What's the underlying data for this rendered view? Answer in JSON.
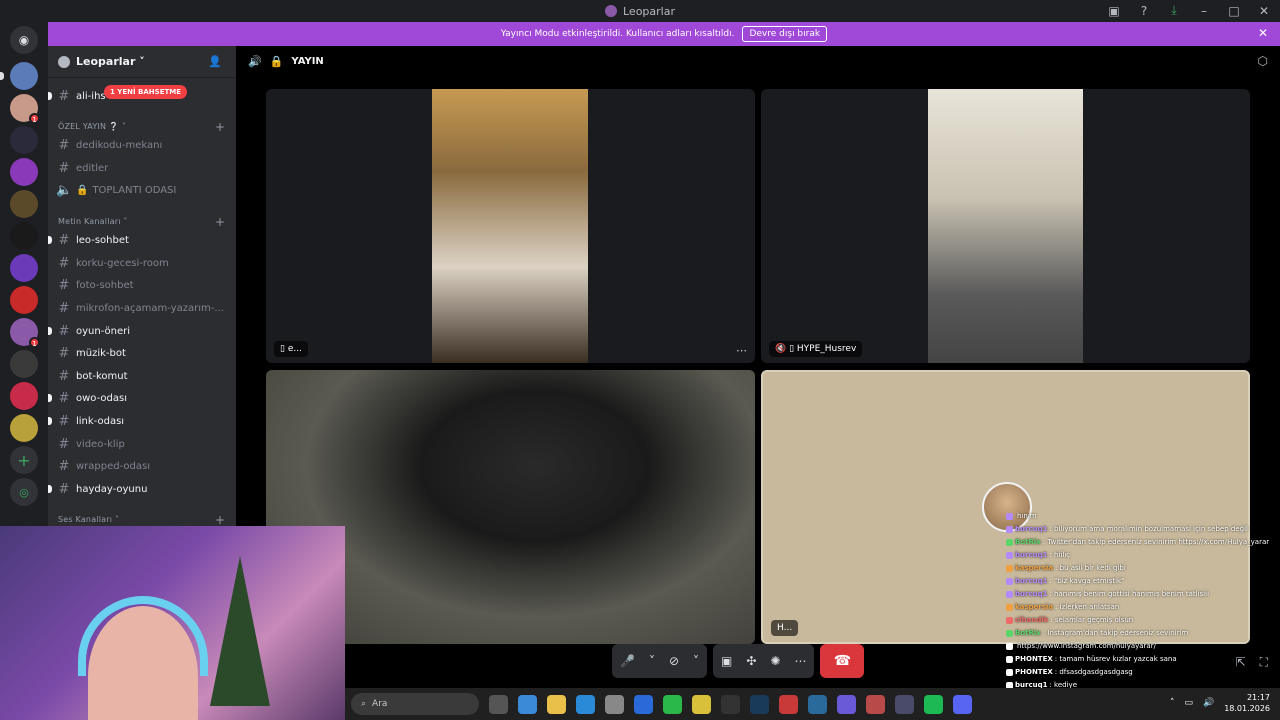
{
  "window": {
    "title": "Leoparlar"
  },
  "banner": {
    "text": "Yayıncı Modu etkinleştirildi. Kullanıcı adları kısaltıldı.",
    "button": "Devre dışı bırak"
  },
  "guild": {
    "name": "Leoparlar ˅"
  },
  "channels": {
    "first": {
      "name": "ali-ihs",
      "mention": "1 YENİ BAHSETME"
    },
    "cat_ozel": "ÖZEL YAYIN ❔ ˅",
    "ozel": [
      "dedikodu-mekanı",
      "editler",
      "TOPLANTI ODASI"
    ],
    "cat_metin": "Metin Kanalları ˅",
    "metin": [
      {
        "name": "leo-sohbet",
        "unread": true
      },
      {
        "name": "korku-gecesi-room",
        "unread": false
      },
      {
        "name": "foto-sohbet",
        "unread": false
      },
      {
        "name": "mikrofon-açamam-yazarım-...",
        "unread": false
      },
      {
        "name": "oyun-öneri",
        "unread": true
      },
      {
        "name": "müzik-bot",
        "unread": true
      },
      {
        "name": "bot-komut",
        "unread": true
      },
      {
        "name": "owo-odası",
        "unread": true
      },
      {
        "name": "link-odası",
        "unread": true
      },
      {
        "name": "video-klip",
        "unread": false
      },
      {
        "name": "wrapped-odası",
        "unread": false
      },
      {
        "name": "hayday-oyunu",
        "unread": true
      }
    ],
    "cat_ses": "Ses Kanalları ˅"
  },
  "call": {
    "channel": "YAYIN",
    "tiles": [
      {
        "name": "e..."
      },
      {
        "name": "HYPE_Husrev"
      },
      {
        "name": ""
      },
      {
        "name": "H..."
      }
    ]
  },
  "taskbar": {
    "search": "Ara",
    "time": "21:17",
    "date": "18.01.2026"
  },
  "chat": [
    {
      "user": "",
      "color": "#b48aff",
      "text": "hınım"
    },
    {
      "user": "burcuq1",
      "color": "#b48aff",
      "text": ": biliyorum ama moralimin bozulmamasi için sebep değil"
    },
    {
      "user": "BotRix",
      "color": "#5bd66b",
      "text": ": Twitter'dan takip ederseniz sevinirim https://x.com/Hulya_yarar"
    },
    {
      "user": "burcuq1",
      "color": "#b48aff",
      "text": ": hiiliç"
    },
    {
      "user": "kaspersia",
      "color": "#f0a040",
      "text": ": bu asil bir kedi gibi"
    },
    {
      "user": "burcuq1",
      "color": "#b48aff",
      "text": ": \"biz kavga etmiştik\""
    },
    {
      "user": "burcuq1",
      "color": "#b48aff",
      "text": ": hanımış benim gottisi hanımış benim tatlisiii"
    },
    {
      "user": "kaspersia",
      "color": "#f0a040",
      "text": ": izlerken anlatsan"
    },
    {
      "user": "cihandik",
      "color": "#f06a6a",
      "text": ": selamlar geçmiş olsun"
    },
    {
      "user": "BotRix",
      "color": "#5bd66b",
      "text": ": Instagram'dan takip ederseniz sevinirim"
    },
    {
      "user": "",
      "color": "#ffffff",
      "text": "https://www.instagram.com/hulyayarar/"
    },
    {
      "user": "PHONTEX",
      "color": "#ffffff",
      "text": ": tamam hüsrev kızlar yazcak sana"
    },
    {
      "user": "PHONTEX",
      "color": "#ffffff",
      "text": ": dfsasdgasdgasdgasg"
    },
    {
      "user": "burcuq1",
      "color": "#ffffff",
      "text": ": kediye"
    },
    {
      "user": "burcuq1",
      "color": "#ffffff",
      "text": ": 🐈"
    },
    {
      "user": "burcuq1",
      "color": "#ffffff",
      "text": ": 🐈"
    }
  ]
}
